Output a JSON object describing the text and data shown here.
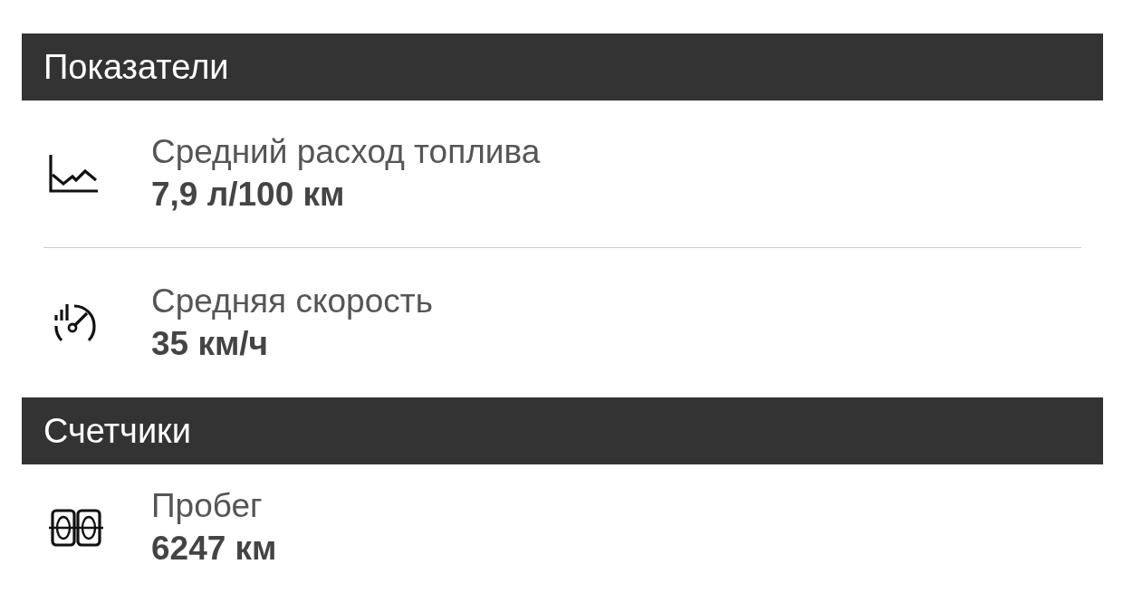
{
  "sections": [
    {
      "title": "Показатели",
      "items": [
        {
          "kind": "consumption",
          "label": "Средний расход топлива",
          "value": "7,9 л/100 км"
        },
        {
          "kind": "speed",
          "label": "Средняя скорость",
          "value": "35 км/ч"
        }
      ]
    },
    {
      "title": "Счетчики",
      "items": [
        {
          "kind": "odometer",
          "label": "Пробег",
          "value": "6247 км"
        }
      ]
    }
  ]
}
